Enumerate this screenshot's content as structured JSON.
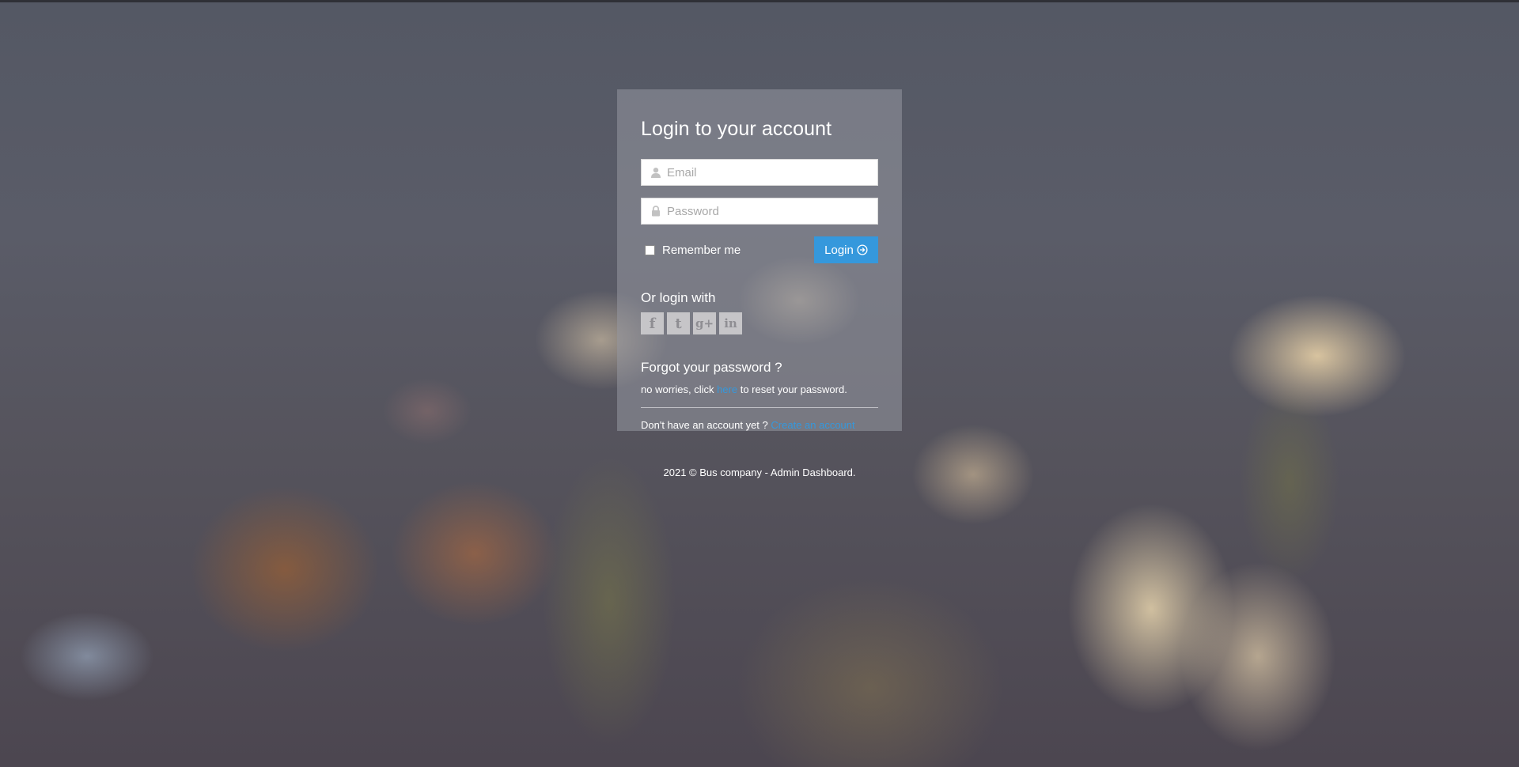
{
  "login": {
    "title": "Login to your account",
    "email": {
      "placeholder": "Email",
      "value": "",
      "icon": "user-icon"
    },
    "password": {
      "placeholder": "Password",
      "value": "",
      "icon": "lock-icon"
    },
    "remember_label": "Remember me",
    "remember_checked": false,
    "login_button_label": "Login",
    "login_button_icon": "arrow-circle-right-icon",
    "accent_color": "#3598dc"
  },
  "social": {
    "title": "Or login with",
    "providers": [
      {
        "name": "facebook",
        "glyph": "f",
        "icon": "facebook-icon"
      },
      {
        "name": "twitter",
        "glyph": "t",
        "icon": "twitter-icon"
      },
      {
        "name": "google-plus",
        "glyph": "g+",
        "icon": "google-plus-icon"
      },
      {
        "name": "linkedin",
        "glyph": "in",
        "icon": "linkedin-icon"
      }
    ]
  },
  "forgot": {
    "title": "Forgot your password ?",
    "text_before": "no worries, click ",
    "link_label": "here",
    "text_after": " to reset your password."
  },
  "create": {
    "text": "Don't have an account yet ?",
    "link_label": "Create an account"
  },
  "footer": {
    "copyright": "2021 © Bus company - Admin Dashboard."
  }
}
